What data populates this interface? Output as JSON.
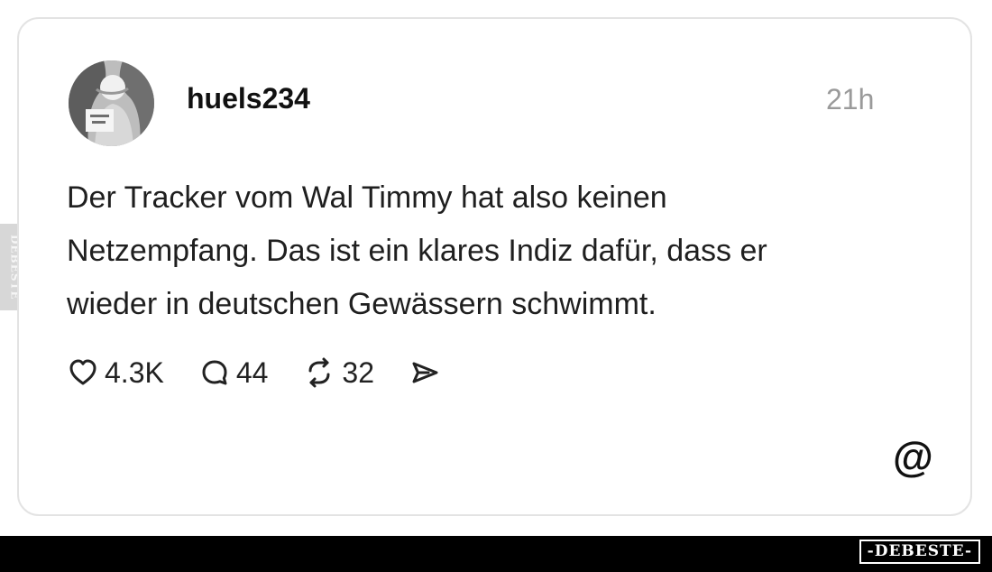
{
  "watermark": {
    "side_text": "DEBESTE",
    "bottom_text": "-DEBESTE-"
  },
  "post": {
    "username": "huels234",
    "timestamp": "21h",
    "text_lines": [
      "Der Tracker vom Wal Timmy hat also keinen",
      "Netzempfang. Das ist ein klares Indiz dafür, dass er",
      "wieder in deutschen Gewässern schwimmt."
    ],
    "actions": {
      "likes": "4.3K",
      "comments": "44",
      "reposts": "32"
    },
    "icons": {
      "like": "heart-icon",
      "comment": "comment-bubble-icon",
      "repost": "repost-icon",
      "share": "send-icon",
      "brand": "threads-logo-icon"
    }
  }
}
